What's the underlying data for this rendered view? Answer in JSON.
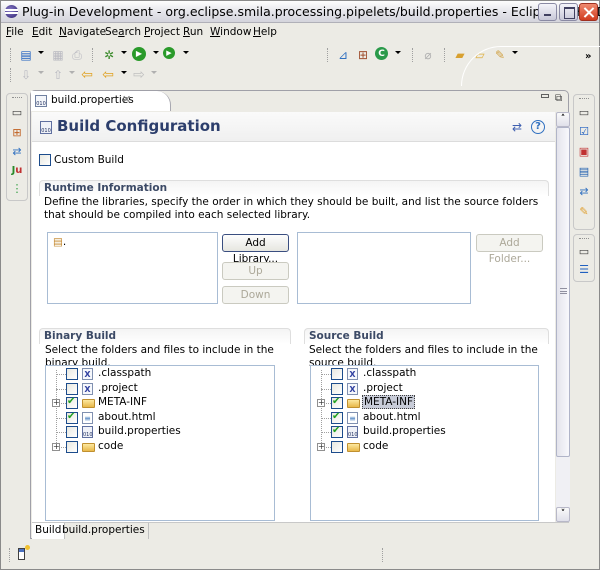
{
  "window": {
    "title": "Plug-in Development - org.eclipse.smila.processing.pipelets/build.properties - Eclipse SDK - D...",
    "buttons": [
      "minimize",
      "maximize",
      "close"
    ]
  },
  "menubar": {
    "items": [
      {
        "label": "File",
        "mnemonic": "F"
      },
      {
        "label": "Edit",
        "mnemonic": "E"
      },
      {
        "label": "Navigate",
        "mnemonic": "N"
      },
      {
        "label": "Search",
        "mnemonic": "a"
      },
      {
        "label": "Project",
        "mnemonic": "P"
      },
      {
        "label": "Run",
        "mnemonic": "R"
      },
      {
        "label": "Window",
        "mnemonic": "W"
      },
      {
        "label": "Help",
        "mnemonic": "H"
      }
    ]
  },
  "toolbar": {
    "row1": [
      "new-wizard-icon",
      "save-icon",
      "print-icon",
      "debug-icon",
      "run-icon",
      "external-tools-icon",
      "new-java-project-icon",
      "new-package-icon",
      "new-class-icon",
      "link-icon",
      "open-type-icon",
      "open-task-icon",
      "search-icon"
    ],
    "row2": [
      "next-annotation-icon",
      "previous-annotation-icon",
      "last-edit-location-icon",
      "back-icon",
      "forward-icon"
    ],
    "overflow_label": "»"
  },
  "left_trim": {
    "icons": [
      "restore-icon",
      "package-explorer-icon",
      "hierarchy-icon",
      "junit-icon",
      "plugins-icon"
    ]
  },
  "right_trim": {
    "group1": [
      "restore-icon",
      "tasks-icon",
      "problems-icon",
      "console-icon",
      "hierarchy-icon",
      "highlighter-icon"
    ],
    "group2": [
      "restore-icon",
      "outline-icon"
    ]
  },
  "editor": {
    "tab_label": "build.properties",
    "form_title": "Build Configuration",
    "custom_build_label": "Custom Build",
    "custom_build_checked": false,
    "runtime": {
      "title": "Runtime Information",
      "description": "Define the libraries, specify the order in which they should be built, and list the source folders that should be compiled into each selected library.",
      "libraries": [
        "."
      ],
      "add_library_label": "Add Library...",
      "up_label": "Up",
      "down_label": "Down",
      "add_folder_label": "Add Folder..."
    },
    "binary_build": {
      "title": "Binary Build",
      "description": "Select the folders and files to include in the binary build.",
      "items": [
        {
          "label": ".classpath",
          "type": "xml",
          "checked": false,
          "expandable": false
        },
        {
          "label": ".project",
          "type": "xml",
          "checked": false,
          "expandable": false
        },
        {
          "label": "META-INF",
          "type": "folder",
          "checked": true,
          "expandable": true
        },
        {
          "label": "about.html",
          "type": "html",
          "checked": true,
          "expandable": false
        },
        {
          "label": "build.properties",
          "type": "properties",
          "checked": false,
          "expandable": false
        },
        {
          "label": "code",
          "type": "folder",
          "checked": false,
          "expandable": true
        }
      ]
    },
    "source_build": {
      "title": "Source Build",
      "description": "Select the folders and files to include in the source build.",
      "items": [
        {
          "label": ".classpath",
          "type": "xml",
          "checked": false,
          "expandable": false
        },
        {
          "label": ".project",
          "type": "xml",
          "checked": false,
          "expandable": false
        },
        {
          "label": "META-INF",
          "type": "folder",
          "checked": true,
          "expandable": true,
          "selected": true
        },
        {
          "label": "about.html",
          "type": "html",
          "checked": true,
          "expandable": false
        },
        {
          "label": "build.properties",
          "type": "properties",
          "checked": true,
          "expandable": false
        },
        {
          "label": "code",
          "type": "folder",
          "checked": false,
          "expandable": true
        }
      ]
    },
    "bottom_tabs": [
      {
        "label": "Build",
        "active": true
      },
      {
        "label": "build.properties",
        "active": false
      }
    ]
  }
}
